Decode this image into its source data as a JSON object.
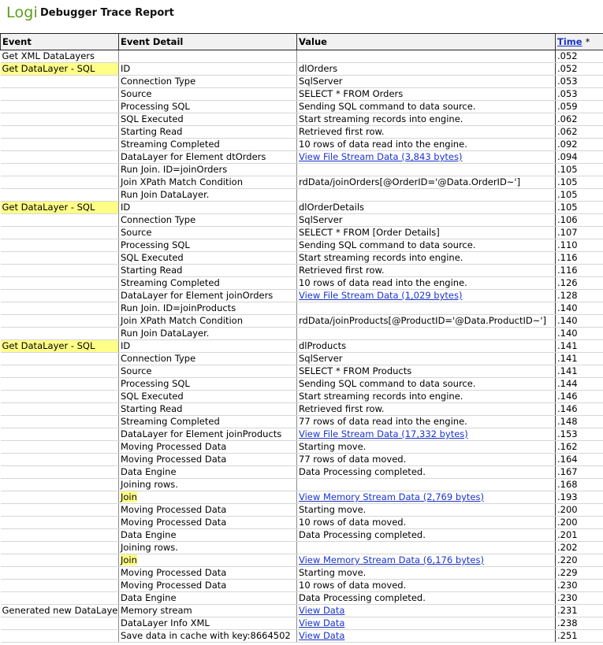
{
  "header": {
    "logo": "Logi",
    "title": "Debugger Trace Report"
  },
  "columns": {
    "event": "Event",
    "detail": "Event Detail",
    "value": "Value",
    "time": "Time",
    "time_suffix": "*"
  },
  "rows": [
    {
      "event": "Get XML DataLayers",
      "event_hl": false,
      "detail": "",
      "detail_hl": false,
      "value": "",
      "link": false,
      "time": ".052"
    },
    {
      "event": "Get DataLayer - SQL",
      "event_hl": true,
      "detail": "ID",
      "detail_hl": false,
      "value": "dlOrders",
      "link": false,
      "time": ".052"
    },
    {
      "event": "",
      "event_hl": false,
      "detail": "Connection Type",
      "detail_hl": false,
      "value": "SqlServer",
      "link": false,
      "time": ".053"
    },
    {
      "event": "",
      "event_hl": false,
      "detail": "Source",
      "detail_hl": false,
      "value": "SELECT * FROM Orders",
      "link": false,
      "time": ".053"
    },
    {
      "event": "",
      "event_hl": false,
      "detail": "Processing SQL",
      "detail_hl": false,
      "value": "Sending SQL command to data source.",
      "link": false,
      "time": ".059"
    },
    {
      "event": "",
      "event_hl": false,
      "detail": "SQL Executed",
      "detail_hl": false,
      "value": "Start streaming records into engine.",
      "link": false,
      "time": ".062"
    },
    {
      "event": "",
      "event_hl": false,
      "detail": "Starting Read",
      "detail_hl": false,
      "value": "Retrieved first row.",
      "link": false,
      "time": ".062"
    },
    {
      "event": "",
      "event_hl": false,
      "detail": "Streaming Completed",
      "detail_hl": false,
      "value": "10 rows of data read into the engine.",
      "link": false,
      "time": ".092"
    },
    {
      "event": "",
      "event_hl": false,
      "detail": "DataLayer for Element dtOrders",
      "detail_hl": false,
      "value": "View File Stream Data (3,843 bytes)",
      "link": true,
      "time": ".094"
    },
    {
      "event": "",
      "event_hl": false,
      "detail": "Run Join. ID=joinOrders",
      "detail_hl": false,
      "value": "",
      "link": false,
      "time": ".105"
    },
    {
      "event": "",
      "event_hl": false,
      "detail": "Join XPath Match Condition",
      "detail_hl": false,
      "value": "rdData/joinOrders[@OrderID='@Data.OrderID~']",
      "link": false,
      "time": ".105"
    },
    {
      "event": "",
      "event_hl": false,
      "detail": "Run Join DataLayer.",
      "detail_hl": false,
      "value": "",
      "link": false,
      "time": ".105"
    },
    {
      "event": "Get DataLayer - SQL",
      "event_hl": true,
      "detail": "ID",
      "detail_hl": false,
      "value": "dlOrderDetails",
      "link": false,
      "time": ".105"
    },
    {
      "event": "",
      "event_hl": false,
      "detail": "Connection Type",
      "detail_hl": false,
      "value": "SqlServer",
      "link": false,
      "time": ".106"
    },
    {
      "event": "",
      "event_hl": false,
      "detail": "Source",
      "detail_hl": false,
      "value": "SELECT * FROM [Order Details]",
      "link": false,
      "time": ".107"
    },
    {
      "event": "",
      "event_hl": false,
      "detail": "Processing SQL",
      "detail_hl": false,
      "value": "Sending SQL command to data source.",
      "link": false,
      "time": ".110"
    },
    {
      "event": "",
      "event_hl": false,
      "detail": "SQL Executed",
      "detail_hl": false,
      "value": "Start streaming records into engine.",
      "link": false,
      "time": ".116"
    },
    {
      "event": "",
      "event_hl": false,
      "detail": "Starting Read",
      "detail_hl": false,
      "value": "Retrieved first row.",
      "link": false,
      "time": ".116"
    },
    {
      "event": "",
      "event_hl": false,
      "detail": "Streaming Completed",
      "detail_hl": false,
      "value": "10 rows of data read into the engine.",
      "link": false,
      "time": ".126"
    },
    {
      "event": "",
      "event_hl": false,
      "detail": "DataLayer for Element joinOrders",
      "detail_hl": false,
      "value": "View File Stream Data (1,029 bytes)",
      "link": true,
      "time": ".128"
    },
    {
      "event": "",
      "event_hl": false,
      "detail": "Run Join. ID=joinProducts",
      "detail_hl": false,
      "value": "",
      "link": false,
      "time": ".140"
    },
    {
      "event": "",
      "event_hl": false,
      "detail": "Join XPath Match Condition",
      "detail_hl": false,
      "value": "rdData/joinProducts[@ProductID='@Data.ProductID~']",
      "link": false,
      "time": ".140"
    },
    {
      "event": "",
      "event_hl": false,
      "detail": "Run Join DataLayer.",
      "detail_hl": false,
      "value": "",
      "link": false,
      "time": ".140"
    },
    {
      "event": "Get DataLayer - SQL",
      "event_hl": true,
      "detail": "ID",
      "detail_hl": false,
      "value": "dlProducts",
      "link": false,
      "time": ".141"
    },
    {
      "event": "",
      "event_hl": false,
      "detail": "Connection Type",
      "detail_hl": false,
      "value": "SqlServer",
      "link": false,
      "time": ".141"
    },
    {
      "event": "",
      "event_hl": false,
      "detail": "Source",
      "detail_hl": false,
      "value": "SELECT * FROM Products",
      "link": false,
      "time": ".141"
    },
    {
      "event": "",
      "event_hl": false,
      "detail": "Processing SQL",
      "detail_hl": false,
      "value": "Sending SQL command to data source.",
      "link": false,
      "time": ".144"
    },
    {
      "event": "",
      "event_hl": false,
      "detail": "SQL Executed",
      "detail_hl": false,
      "value": "Start streaming records into engine.",
      "link": false,
      "time": ".146"
    },
    {
      "event": "",
      "event_hl": false,
      "detail": "Starting Read",
      "detail_hl": false,
      "value": "Retrieved first row.",
      "link": false,
      "time": ".146"
    },
    {
      "event": "",
      "event_hl": false,
      "detail": "Streaming Completed",
      "detail_hl": false,
      "value": "77 rows of data read into the engine.",
      "link": false,
      "time": ".148"
    },
    {
      "event": "",
      "event_hl": false,
      "detail": "DataLayer for Element joinProducts",
      "detail_hl": false,
      "value": "View File Stream Data (17,332 bytes)",
      "link": true,
      "time": ".153"
    },
    {
      "event": "",
      "event_hl": false,
      "detail": "Moving Processed Data",
      "detail_hl": false,
      "value": "Starting move.",
      "link": false,
      "time": ".162"
    },
    {
      "event": "",
      "event_hl": false,
      "detail": "Moving Processed Data",
      "detail_hl": false,
      "value": "77 rows of data moved.",
      "link": false,
      "time": ".164"
    },
    {
      "event": "",
      "event_hl": false,
      "detail": "Data Engine",
      "detail_hl": false,
      "value": "Data Processing completed.",
      "link": false,
      "time": ".167"
    },
    {
      "event": "",
      "event_hl": false,
      "detail": "Joining rows.",
      "detail_hl": false,
      "value": "",
      "link": false,
      "time": ".168"
    },
    {
      "event": "",
      "event_hl": false,
      "detail": "Join",
      "detail_hl": true,
      "value": "View Memory Stream Data (2,769 bytes)",
      "link": true,
      "time": ".193"
    },
    {
      "event": "",
      "event_hl": false,
      "detail": "Moving Processed Data",
      "detail_hl": false,
      "value": "Starting move.",
      "link": false,
      "time": ".200"
    },
    {
      "event": "",
      "event_hl": false,
      "detail": "Moving Processed Data",
      "detail_hl": false,
      "value": "10 rows of data moved.",
      "link": false,
      "time": ".200"
    },
    {
      "event": "",
      "event_hl": false,
      "detail": "Data Engine",
      "detail_hl": false,
      "value": "Data Processing completed.",
      "link": false,
      "time": ".201"
    },
    {
      "event": "",
      "event_hl": false,
      "detail": "Joining rows.",
      "detail_hl": false,
      "value": "",
      "link": false,
      "time": ".202"
    },
    {
      "event": "",
      "event_hl": false,
      "detail": "Join",
      "detail_hl": true,
      "value": "View Memory Stream Data (6,176 bytes)",
      "link": true,
      "time": ".220"
    },
    {
      "event": "",
      "event_hl": false,
      "detail": "Moving Processed Data",
      "detail_hl": false,
      "value": "Starting move.",
      "link": false,
      "time": ".229"
    },
    {
      "event": "",
      "event_hl": false,
      "detail": "Moving Processed Data",
      "detail_hl": false,
      "value": "10 rows of data moved.",
      "link": false,
      "time": ".230"
    },
    {
      "event": "",
      "event_hl": false,
      "detail": "Data Engine",
      "detail_hl": false,
      "value": "Data Processing completed.",
      "link": false,
      "time": ".230"
    },
    {
      "event": "Generated new DataLaye",
      "event_hl": false,
      "detail": "Memory stream",
      "detail_hl": false,
      "value": "View Data",
      "link": true,
      "time": ".231"
    },
    {
      "event": "",
      "event_hl": false,
      "detail": "DataLayer Info XML",
      "detail_hl": false,
      "value": "View Data",
      "link": true,
      "time": ".238"
    },
    {
      "event": "",
      "event_hl": false,
      "detail": "Save data in cache with key:8664502",
      "detail_hl": false,
      "value": "View Data",
      "link": true,
      "time": ".251"
    }
  ],
  "colors": {
    "logo": "#5a9e1a",
    "highlight": "#ffff88",
    "link": "#1a33cc"
  }
}
